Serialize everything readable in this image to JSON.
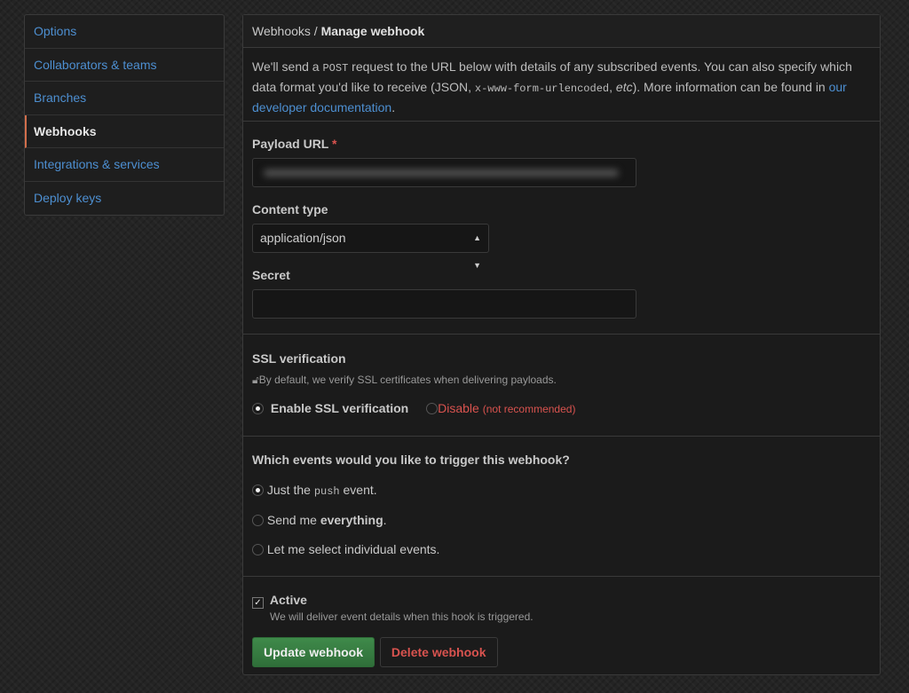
{
  "sidebar": {
    "items": [
      {
        "label": "Options"
      },
      {
        "label": "Collaborators & teams"
      },
      {
        "label": "Branches"
      },
      {
        "label": "Webhooks",
        "selected": true
      },
      {
        "label": "Integrations & services"
      },
      {
        "label": "Deploy keys"
      }
    ]
  },
  "header": {
    "parent": "Webhooks",
    "sep": " / ",
    "title": "Manage webhook"
  },
  "intro": {
    "t1": "We'll send a ",
    "post": "POST",
    "t2": " request to the URL below with details of any subscribed events. You can also specify which data format you'd like to receive (JSON, ",
    "fmt": "x-www-form-urlencoded",
    "t3": ", ",
    "etc": "etc",
    "t4": "). More information can be found in ",
    "link": "our developer documentation",
    "t5": "."
  },
  "form": {
    "payload_label": "Payload URL",
    "required": "*",
    "content_type_label": "Content type",
    "content_type_value": "application/json",
    "secret_label": "Secret",
    "secret_value": ""
  },
  "ssl": {
    "title": "SSL verification",
    "desc": "By default, we verify SSL certificates when delivering payloads.",
    "enable": "Enable SSL verification",
    "disable": "Disable",
    "disable_note": "(not recommended)",
    "selected": "enable"
  },
  "events": {
    "title": "Which events would you like to trigger this webhook?",
    "o1a": "Just the ",
    "o1code": "push",
    "o1b": " event.",
    "o2a": "Send me ",
    "o2b": "everything",
    "o2c": ".",
    "o3": "Let me select individual events.",
    "selected": "push"
  },
  "active": {
    "label": "Active",
    "checked": true,
    "desc": "We will deliver event details when this hook is triggered."
  },
  "buttons": {
    "update": "Update webhook",
    "delete": "Delete webhook"
  },
  "colors": {
    "link": "#4d8fd1",
    "danger": "#d9534f",
    "primary": "#3a7d44"
  }
}
